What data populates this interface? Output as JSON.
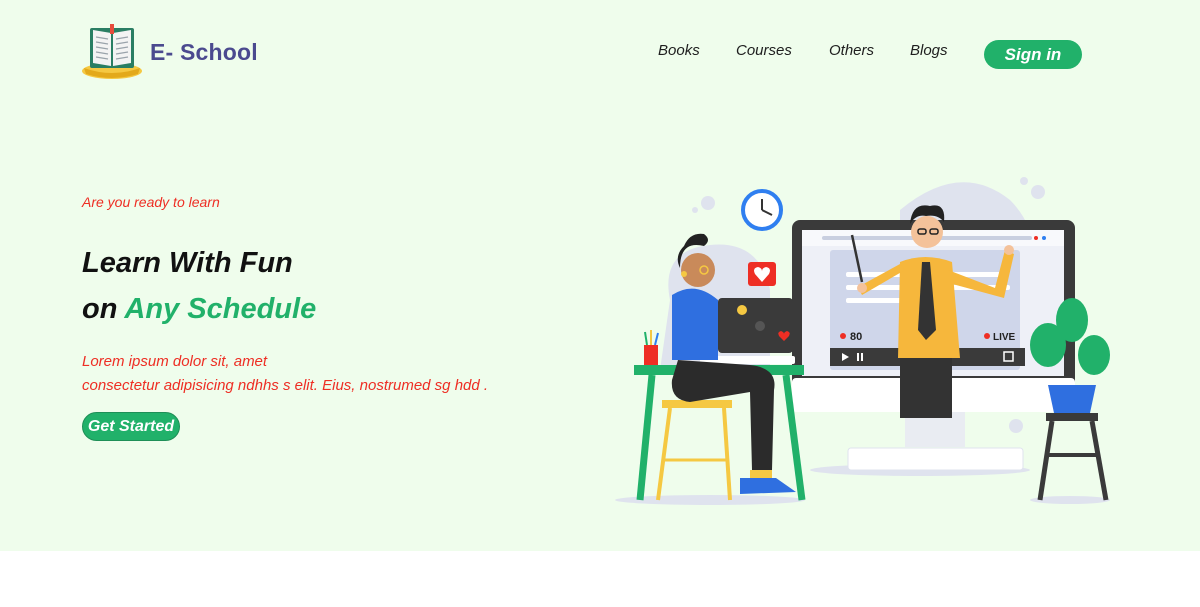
{
  "brand": {
    "name": "E- School",
    "logo_icon": "open-book-icon"
  },
  "nav": {
    "items": [
      {
        "label": "Books"
      },
      {
        "label": "Courses"
      },
      {
        "label": "Others"
      },
      {
        "label": "Blogs"
      }
    ],
    "signin_label": "Sign in"
  },
  "hero": {
    "eyebrow": "Are you ready to learn",
    "headline_line1": "Learn With Fun",
    "headline_line2_prefix": "on",
    "headline_line2_accent": "Any Schedule",
    "desc_line1": "Lorem ipsum dolor sit, amet",
    "desc_line2": "consectetur adipisicing ndhhs s elit. Eius, nostrumed sg hdd .",
    "cta_label": "Get Started"
  },
  "illustration": {
    "viewer_count": "80",
    "live_label": "LIVE"
  },
  "colors": {
    "hero_bg": "#effdec",
    "accent_green": "#21b16a",
    "accent_red": "#ee2e24",
    "brand_purple": "#4b4a8f"
  }
}
